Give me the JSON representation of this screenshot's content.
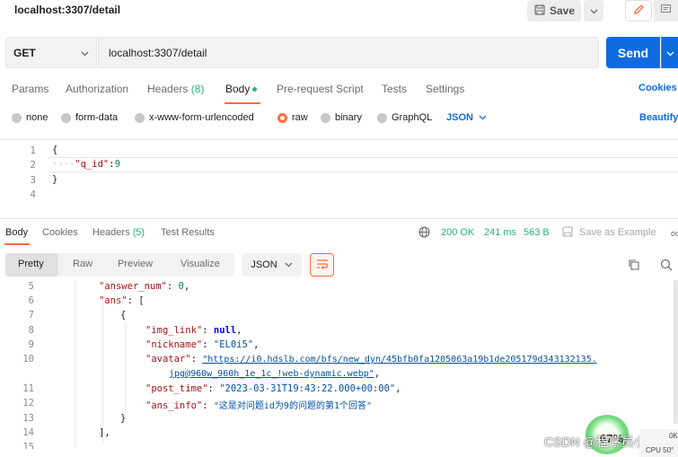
{
  "window": {
    "title": "localhost:3307/detail",
    "save_label": "Save"
  },
  "request": {
    "method": "GET",
    "url": "localhost:3307/detail",
    "send_label": "Send",
    "tabs": [
      {
        "label": "Params"
      },
      {
        "label": "Authorization"
      },
      {
        "label": "Headers",
        "count": "(8)"
      },
      {
        "label": "Body"
      },
      {
        "label": "Pre-request Script"
      },
      {
        "label": "Tests"
      },
      {
        "label": "Settings"
      }
    ],
    "cookies_label": "Cookies",
    "body_types": [
      "none",
      "form-data",
      "x-www-form-urlencoded",
      "raw",
      "binary",
      "GraphQL"
    ],
    "selected_body_type": "raw",
    "format": "JSON",
    "beautify_label": "Beautify",
    "body_lines": [
      {
        "n": "1",
        "text": "{"
      },
      {
        "n": "2",
        "key": "\"q_id\"",
        "value": "9"
      },
      {
        "n": "3",
        "text": "}"
      },
      {
        "n": "4",
        "text": ""
      }
    ]
  },
  "response": {
    "tabs": [
      {
        "label": "Body"
      },
      {
        "label": "Cookies"
      },
      {
        "label": "Headers",
        "count": "(5)"
      },
      {
        "label": "Test Results"
      }
    ],
    "status": "200 OK",
    "time": "241 ms",
    "size": "563 B",
    "save_example": "Save as Example",
    "more": "oo",
    "views": [
      "Pretty",
      "Raw",
      "Preview",
      "Visualize"
    ],
    "format": "JSON",
    "lines": [
      {
        "n": "5",
        "key": "\"answer_num\"",
        "value": "0",
        "suffix": ","
      },
      {
        "n": "6",
        "key": "\"ans\"",
        "value": "["
      },
      {
        "n": "7",
        "text": "{"
      },
      {
        "n": "8",
        "key": "\"img_link\"",
        "value": "null",
        "suffix": ","
      },
      {
        "n": "9",
        "key": "\"nickname\"",
        "value": "\"EL0i5\"",
        "suffix": ","
      },
      {
        "n": "10",
        "key": "\"avatar\"",
        "value": "\"https://i0.hdslb.com/bfs/new_dyn/45bfb0fa1205063a19b1de205179d343132135.",
        "cont": "jpg@960w_960h_1e_1c_!web-dynamic.webp\"",
        "suffix": ","
      },
      {
        "n": "11",
        "key": "\"post_time\"",
        "value": "\"2023-03-31T19:43:22.000+00:00\"",
        "suffix": ","
      },
      {
        "n": "12",
        "key": "\"ans_info\"",
        "value": "\"这是对问题id为9的问题的第1个回答\""
      },
      {
        "n": "13",
        "text": "}"
      },
      {
        "n": "14",
        "text": "],"
      },
      {
        "n": "15",
        "text": ""
      }
    ]
  },
  "overlay": {
    "watermark": "CSDN @程序员小队",
    "blob_text": "67%",
    "taskbar_top": "0K",
    "taskbar_bottom": "CPU 50°"
  }
}
